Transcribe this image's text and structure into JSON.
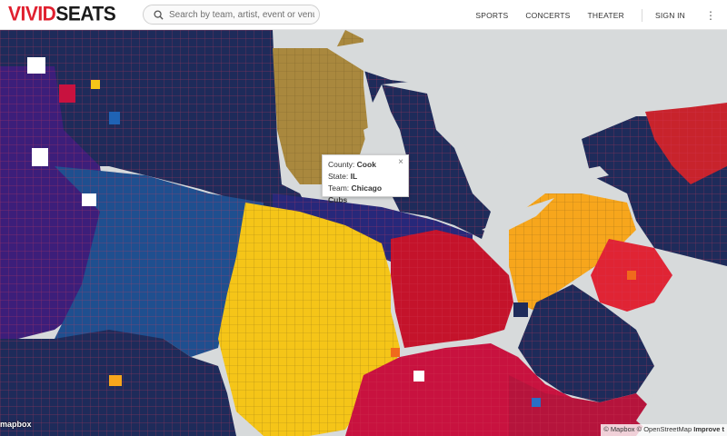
{
  "header": {
    "logo_part1": "VIVID",
    "logo_part2": "SEATS",
    "search_placeholder": "Search by team, artist, event or venue",
    "nav": [
      "SPORTS",
      "CONCERTS",
      "THEATER",
      "SIGN IN"
    ],
    "more_icon": "vertical-dots-icon"
  },
  "tooltip": {
    "county_label": "County:",
    "county_value": "Cook",
    "state_label": "State:",
    "state_value": "IL",
    "team_label": "Team:",
    "team_value": "Chicago Cubs",
    "close": "×"
  },
  "map": {
    "water_color": "#d7dadb",
    "team_colors": {
      "navy": "#1e2b5a",
      "blue": "#1f4f8f",
      "purple": "#3c1e7a",
      "gold": "#a9883e",
      "yellow": "#f5c518",
      "red": "#c4132b",
      "orange": "#f7a61c",
      "crimson": "#c8123f"
    },
    "mapbox_logo": "mapbox",
    "attribution": "© Mapbox © OpenStreetMap",
    "improve": "Improve t"
  }
}
